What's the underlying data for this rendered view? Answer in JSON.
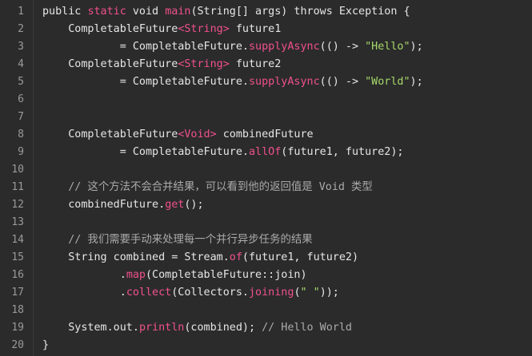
{
  "lines": [
    {
      "n": "1",
      "tokens": [
        {
          "t": "public ",
          "c": "plain"
        },
        {
          "t": "static",
          "c": "pink"
        },
        {
          "t": " void ",
          "c": "plain"
        },
        {
          "t": "main",
          "c": "pink"
        },
        {
          "t": "(String[] args) throws Exception {",
          "c": "plain"
        }
      ]
    },
    {
      "n": "2",
      "tokens": [
        {
          "t": "    CompletableFuture",
          "c": "plain"
        },
        {
          "t": "<String>",
          "c": "pink"
        },
        {
          "t": " future1",
          "c": "plain"
        }
      ]
    },
    {
      "n": "3",
      "tokens": [
        {
          "t": "            = CompletableFuture.",
          "c": "plain"
        },
        {
          "t": "supplyAsync",
          "c": "pink"
        },
        {
          "t": "(() -> ",
          "c": "plain"
        },
        {
          "t": "\"Hello\"",
          "c": "str"
        },
        {
          "t": ");",
          "c": "plain"
        }
      ]
    },
    {
      "n": "4",
      "tokens": [
        {
          "t": "    CompletableFuture",
          "c": "plain"
        },
        {
          "t": "<String>",
          "c": "pink"
        },
        {
          "t": " future2",
          "c": "plain"
        }
      ]
    },
    {
      "n": "5",
      "tokens": [
        {
          "t": "            = CompletableFuture.",
          "c": "plain"
        },
        {
          "t": "supplyAsync",
          "c": "pink"
        },
        {
          "t": "(() -> ",
          "c": "plain"
        },
        {
          "t": "\"World\"",
          "c": "str"
        },
        {
          "t": ");",
          "c": "plain"
        }
      ]
    },
    {
      "n": "6",
      "tokens": []
    },
    {
      "n": "7",
      "tokens": []
    },
    {
      "n": "8",
      "tokens": [
        {
          "t": "    CompletableFuture",
          "c": "plain"
        },
        {
          "t": "<Void>",
          "c": "pink"
        },
        {
          "t": " combinedFuture",
          "c": "plain"
        }
      ]
    },
    {
      "n": "9",
      "tokens": [
        {
          "t": "            = CompletableFuture.",
          "c": "plain"
        },
        {
          "t": "allOf",
          "c": "pink"
        },
        {
          "t": "(future1, future2);",
          "c": "plain"
        }
      ]
    },
    {
      "n": "10",
      "tokens": []
    },
    {
      "n": "11",
      "tokens": [
        {
          "t": "    // 这个方法不会合并结果，可以看到他的返回值是 Void 类型",
          "c": "cm"
        }
      ]
    },
    {
      "n": "12",
      "tokens": [
        {
          "t": "    combinedFuture.",
          "c": "plain"
        },
        {
          "t": "get",
          "c": "pink"
        },
        {
          "t": "();",
          "c": "plain"
        }
      ]
    },
    {
      "n": "13",
      "tokens": []
    },
    {
      "n": "14",
      "tokens": [
        {
          "t": "    // 我们需要手动来处理每一个并行异步任务的结果",
          "c": "cm"
        }
      ]
    },
    {
      "n": "15",
      "tokens": [
        {
          "t": "    String combined = Stream.",
          "c": "plain"
        },
        {
          "t": "of",
          "c": "pink"
        },
        {
          "t": "(future1, future2)",
          "c": "plain"
        }
      ]
    },
    {
      "n": "16",
      "tokens": [
        {
          "t": "            .",
          "c": "plain"
        },
        {
          "t": "map",
          "c": "pink"
        },
        {
          "t": "(CompletableFuture::join)",
          "c": "plain"
        }
      ]
    },
    {
      "n": "17",
      "tokens": [
        {
          "t": "            .",
          "c": "plain"
        },
        {
          "t": "collect",
          "c": "pink"
        },
        {
          "t": "(Collectors.",
          "c": "plain"
        },
        {
          "t": "joining",
          "c": "pink"
        },
        {
          "t": "(",
          "c": "plain"
        },
        {
          "t": "\" \"",
          "c": "str"
        },
        {
          "t": "));",
          "c": "plain"
        }
      ]
    },
    {
      "n": "18",
      "tokens": []
    },
    {
      "n": "19",
      "tokens": [
        {
          "t": "    System.out.",
          "c": "plain"
        },
        {
          "t": "println",
          "c": "pink"
        },
        {
          "t": "(combined); ",
          "c": "plain"
        },
        {
          "t": "// Hello World",
          "c": "cm"
        }
      ]
    },
    {
      "n": "20",
      "tokens": [
        {
          "t": "}",
          "c": "plain"
        }
      ]
    }
  ],
  "theme": {
    "background": "#2b2b2b",
    "text": "#e6e6e6",
    "keyword_accent": "#f0508c",
    "string": "#a6d96a",
    "comment": "#aaaaaa",
    "line_number": "#9a9a9a"
  }
}
